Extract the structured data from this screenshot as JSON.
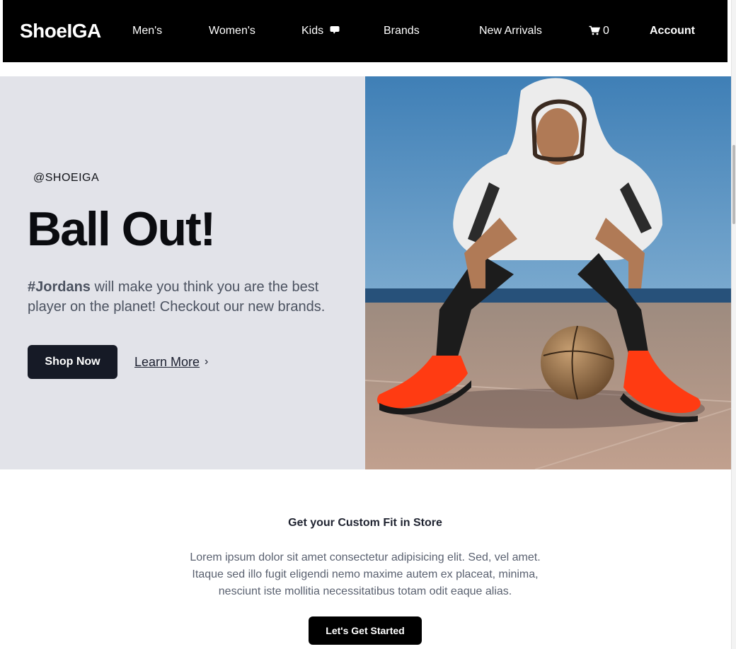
{
  "nav": {
    "brand": "ShoeIGA",
    "links": [
      {
        "label": "Men's"
      },
      {
        "label": "Women's"
      },
      {
        "label": "Kids",
        "icon": "chat-bubble-icon"
      },
      {
        "label": "Brands"
      },
      {
        "label": "New Arrivals"
      }
    ],
    "cart_count": "0",
    "cart_icon": "cart-icon",
    "account": "Account"
  },
  "hero": {
    "handle": "@SHOEIGA",
    "title": "Ball Out!",
    "hashtag": "#Jordans",
    "description": " will make you think you are the best player on the planet! Checkout our new brands.",
    "primary_button": "Shop Now",
    "secondary_link": "Learn More",
    "chevron": "›"
  },
  "custom_fit": {
    "title": "Get your Custom Fit in Store",
    "body": "Lorem ipsum dolor sit amet consectetur adipisicing elit. Sed, vel amet. Itaque sed illo fugit eligendi nemo maxime autem ex placeat, minima, nesciunt iste mollitia necessitatibus totam odit eaque alias.",
    "button": "Let's Get Started"
  },
  "colors": {
    "nav_bg": "#000000",
    "hero_bg": "#e2e3e9",
    "primary_button": "#161a26",
    "sky": "#4f8fc2",
    "shoes": "#ff3b12"
  }
}
